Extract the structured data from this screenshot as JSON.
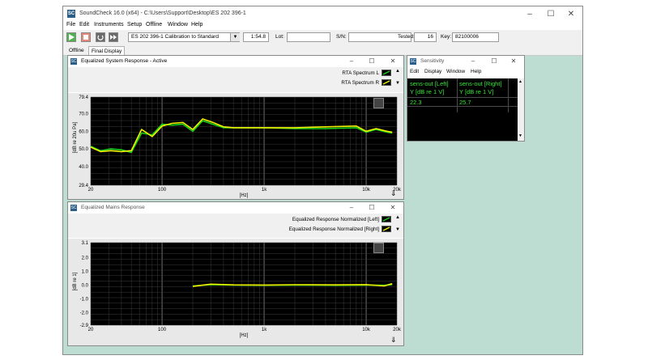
{
  "app": {
    "title": "SoundCheck 16.0 (x64) - C:\\Users\\Support\\Desktop\\ES 202 396-1",
    "icon_text": "SC",
    "window_controls": [
      "minimize-icon",
      "maximize-icon",
      "close-icon"
    ]
  },
  "menu": [
    "File",
    "Edit",
    "Instruments",
    "Setup",
    "Offline",
    "Window",
    "Help"
  ],
  "toolbar": {
    "sequence": "ES 202 396-1 Calibration to Standard",
    "time": "1:54.8",
    "lot_label": "Lot:",
    "lot_value": "",
    "sn_label": "S/N:",
    "sn_value": "",
    "tested_label": "Tested:",
    "tested_value": "16",
    "key_label": "Key:",
    "key_value": "82100006",
    "buttons": [
      "run-icon",
      "stop-icon",
      "step-icon",
      "skip-icon"
    ],
    "colors": {
      "run": "#4fb24f",
      "stop": "#e58a7a"
    }
  },
  "tabs": [
    "Offline",
    "Final Display"
  ],
  "window1": {
    "title": "Equalized System Response - Active",
    "legend": [
      {
        "label": "RTA Spectrum L",
        "color": "#19d119"
      },
      {
        "label": "RTA Spectrum R",
        "color": "#f0f000"
      }
    ],
    "y_ticks": [
      "79.4",
      "70.0",
      "60.0",
      "50.0",
      "40.0",
      "29.4"
    ],
    "x_ticks": [
      "20",
      "100",
      "1k",
      "10k",
      "20k"
    ],
    "ylabel": "[dB re 20u Pa]",
    "xlabel": "[Hz]"
  },
  "window2": {
    "title": "Equalized Mains Response",
    "legend": [
      {
        "label": "Equalized Response Normalized [Left]",
        "color": "#19d119"
      },
      {
        "label": "Equalized Response Normalized [Right]",
        "color": "#f0f000"
      }
    ],
    "y_ticks": [
      "3.1",
      "2.0",
      "1.0",
      "0.0",
      "-1.0",
      "-2.0",
      "-2.9"
    ],
    "x_ticks": [
      "20",
      "100",
      "1k",
      "10k",
      "20k"
    ],
    "ylabel": "[dB re 1]",
    "xlabel": "[Hz]"
  },
  "sensitivity": {
    "title": "Sensitivity",
    "menu": [
      "Edit",
      "Display",
      "Window",
      "Help"
    ],
    "headers": [
      {
        "line1": "sens-out [Left]",
        "line2": "Y [dB re 1 V]"
      },
      {
        "line1": "sens-out [Right]",
        "line2": "Y [dB re 1 V]"
      }
    ],
    "values": [
      "22.3",
      "25.7"
    ]
  },
  "chart_data": [
    {
      "type": "line",
      "title": "Equalized System Response - Active",
      "xlabel": "[Hz]",
      "ylabel": "[dB re 20u Pa]",
      "x_scale": "log",
      "xlim": [
        20,
        20000
      ],
      "ylim": [
        29.4,
        79.4
      ],
      "grid": true,
      "legend": "top-right",
      "series": [
        {
          "name": "RTA Spectrum L",
          "color": "#19d119",
          "points": [
            [
              20,
              51.5
            ],
            [
              25,
              49
            ],
            [
              31.5,
              50
            ],
            [
              40,
              49.5
            ],
            [
              50,
              48
            ],
            [
              63,
              59
            ],
            [
              80,
              58
            ],
            [
              100,
              64
            ],
            [
              125,
              63.5
            ],
            [
              160,
              64
            ],
            [
              200,
              60
            ],
            [
              250,
              66
            ],
            [
              315,
              64
            ],
            [
              400,
              62
            ],
            [
              500,
              62
            ],
            [
              1000,
              62
            ],
            [
              2000,
              61.5
            ],
            [
              4000,
              61.5
            ],
            [
              8000,
              62
            ],
            [
              10000,
              59.5
            ],
            [
              12500,
              61
            ],
            [
              16000,
              59.5
            ],
            [
              18000,
              59
            ]
          ]
        },
        {
          "name": "RTA Spectrum R",
          "color": "#f0f000",
          "points": [
            [
              20,
              51
            ],
            [
              25,
              48.5
            ],
            [
              31.5,
              49
            ],
            [
              40,
              48.5
            ],
            [
              50,
              49
            ],
            [
              63,
              61
            ],
            [
              80,
              57
            ],
            [
              100,
              63
            ],
            [
              125,
              64.5
            ],
            [
              160,
              65
            ],
            [
              200,
              61
            ],
            [
              250,
              67
            ],
            [
              315,
              65
            ],
            [
              400,
              62.5
            ],
            [
              500,
              62
            ],
            [
              1000,
              62
            ],
            [
              2000,
              62
            ],
            [
              4000,
              62.5
            ],
            [
              8000,
              63
            ],
            [
              10000,
              60
            ],
            [
              12500,
              61.5
            ],
            [
              16000,
              60
            ],
            [
              18000,
              59.5
            ]
          ]
        }
      ]
    },
    {
      "type": "line",
      "title": "Equalized Mains Response",
      "xlabel": "[Hz]",
      "ylabel": "[dB re 1]",
      "x_scale": "log",
      "xlim": [
        20,
        20000
      ],
      "ylim": [
        -2.9,
        3.1
      ],
      "grid": true,
      "legend": "top-right",
      "series": [
        {
          "name": "Equalized Response Normalized [Left]",
          "color": "#19d119",
          "points": [
            [
              200,
              -0.05
            ],
            [
              300,
              0.05
            ],
            [
              500,
              0.02
            ],
            [
              1000,
              0.0
            ],
            [
              2000,
              0.02
            ],
            [
              5000,
              0.0
            ],
            [
              10000,
              0.02
            ],
            [
              15000,
              0.0
            ],
            [
              18000,
              0.05
            ]
          ]
        },
        {
          "name": "Equalized Response Normalized [Right]",
          "color": "#f0f000",
          "points": [
            [
              200,
              -0.08
            ],
            [
              300,
              0.08
            ],
            [
              500,
              0.03
            ],
            [
              1000,
              0.02
            ],
            [
              2000,
              0.04
            ],
            [
              5000,
              0.03
            ],
            [
              10000,
              0.05
            ],
            [
              15000,
              -0.05
            ],
            [
              18000,
              0.12
            ]
          ]
        }
      ]
    }
  ]
}
